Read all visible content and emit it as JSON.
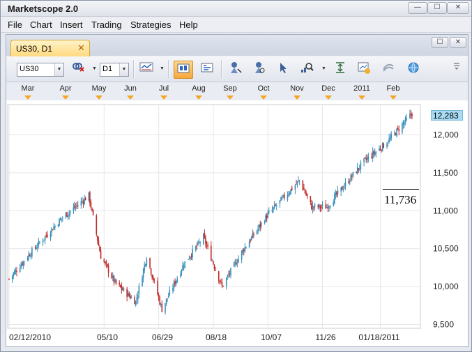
{
  "window": {
    "title": "Marketscope 2.0",
    "min_glyph": "—",
    "max_glyph": "☐",
    "close_glyph": "✕"
  },
  "menu": [
    "File",
    "Chart",
    "Insert",
    "Trading",
    "Strategies",
    "Help"
  ],
  "tab": {
    "label": "US30, D1",
    "close_glyph": "✕"
  },
  "doc_buttons": {
    "restore_glyph": "☐",
    "close_glyph": "✕"
  },
  "toolbar": {
    "instrument": "US30",
    "timeframe": "D1",
    "dropdown_glyph": "▼"
  },
  "months": [
    "Mar",
    "Apr",
    "May",
    "Jun",
    "Jul",
    "Aug",
    "Sep",
    "Oct",
    "Nov",
    "Dec",
    "2011",
    "Feb"
  ],
  "price_marker": "11,736",
  "current_price": "12,283",
  "colors": {
    "up": "#3a8fb8",
    "down": "#c42828",
    "accent": "#f5a623",
    "current_price_bg": "#a9dcf4"
  },
  "chart_data": {
    "type": "candlestick",
    "instrument": "US30",
    "timeframe": "D1",
    "x_tick_labels": [
      "02/12/2010",
      "05/10",
      "06/29",
      "08/18",
      "10/07",
      "11/26",
      "01/18/2011"
    ],
    "y_tick_labels": [
      "12,000",
      "11,500",
      "11,000",
      "10,500",
      "10,000",
      "9,500"
    ],
    "ylim": [
      9450,
      12400
    ],
    "grid": true,
    "close_path": [
      {
        "date": "2010-02-12",
        "close": 10100
      },
      {
        "date": "2010-03-01",
        "close": 10400
      },
      {
        "date": "2010-04-01",
        "close": 10900
      },
      {
        "date": "2010-04-26",
        "close": 11200
      },
      {
        "date": "2010-05-07",
        "close": 10400
      },
      {
        "date": "2010-05-20",
        "close": 10050
      },
      {
        "date": "2010-06-08",
        "close": 9800
      },
      {
        "date": "2010-06-18",
        "close": 10400
      },
      {
        "date": "2010-07-02",
        "close": 9700
      },
      {
        "date": "2010-07-22",
        "close": 10300
      },
      {
        "date": "2010-08-09",
        "close": 10650
      },
      {
        "date": "2010-08-26",
        "close": 10000
      },
      {
        "date": "2010-09-15",
        "close": 10500
      },
      {
        "date": "2010-10-07",
        "close": 10950
      },
      {
        "date": "2010-11-05",
        "close": 11400
      },
      {
        "date": "2010-11-16",
        "close": 11050
      },
      {
        "date": "2010-11-30",
        "close": 11050
      },
      {
        "date": "2011-01-03",
        "close": 11650
      },
      {
        "date": "2011-01-24",
        "close": 11900
      },
      {
        "date": "2011-02-16",
        "close": 12283
      }
    ]
  }
}
